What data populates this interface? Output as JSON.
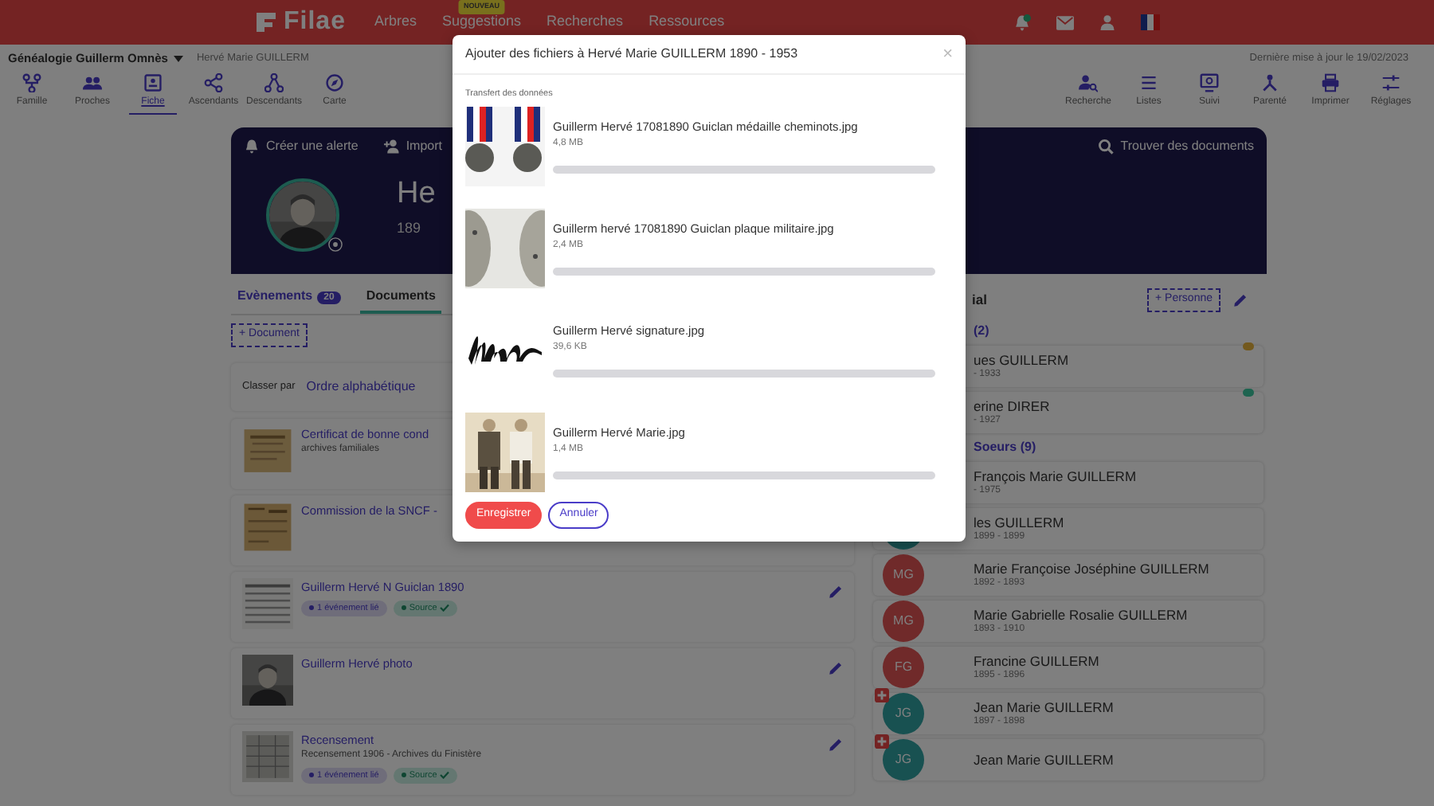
{
  "topbar": {
    "logo": "Filae",
    "has_notification": true,
    "nav": [
      {
        "label": "Arbres"
      },
      {
        "label": "Suggestions",
        "badge": "NOUVEAU"
      },
      {
        "label": "Recherches"
      },
      {
        "label": "Ressources"
      }
    ]
  },
  "tree": {
    "name": "Généalogie Guillerm Omnès",
    "person": "Hervé Marie GUILLERM",
    "updated": "Dernière mise à jour le 19/02/2023"
  },
  "toolbar_left": [
    {
      "label": "Famille",
      "selected": false
    },
    {
      "label": "Proches",
      "selected": false
    },
    {
      "label": "Fiche",
      "selected": true
    },
    {
      "label": "Ascendants",
      "selected": false
    },
    {
      "label": "Descendants",
      "selected": false
    },
    {
      "label": "Carte",
      "selected": false
    }
  ],
  "toolbar_right": [
    {
      "label": "Recherche",
      "selected": false
    },
    {
      "label": "Listes",
      "selected": false
    },
    {
      "label": "Suivi",
      "selected": false
    },
    {
      "label": "Parenté",
      "selected": false
    },
    {
      "label": "Imprimer",
      "selected": false
    },
    {
      "label": "Réglages",
      "selected": false
    }
  ],
  "profile": {
    "actions": [
      "Créer une alerte",
      "Import"
    ],
    "find": "Trouver des documents",
    "name": "He",
    "dates": "189"
  },
  "tabs": [
    {
      "label": "Evènements",
      "count": "20",
      "selected": false
    },
    {
      "label": "Documents",
      "selected": true
    }
  ],
  "add_document": "+ Document",
  "sort": {
    "label": "Classer par",
    "value": "Ordre alphabétique"
  },
  "documents": [
    {
      "title": "Certificat de bonne cond",
      "subtitle": "archives familiales",
      "edit": false
    },
    {
      "title": "Commission de la SNCF -",
      "edit": false
    },
    {
      "title": "Guillerm Hervé N Guiclan 1890",
      "chips": [
        {
          "label": "1 événement lié",
          "kind": "link"
        },
        {
          "label": "Source",
          "kind": "source"
        }
      ],
      "edit": true
    },
    {
      "title": "Guillerm Hervé photo",
      "edit": true
    },
    {
      "title": "Recensement",
      "subtitle": "Recensement 1906 - Archives du Finistère",
      "chips": [
        {
          "label": "1 événement lié",
          "kind": "link"
        },
        {
          "label": "Source",
          "kind": "source"
        }
      ],
      "edit": true
    }
  ],
  "family": {
    "title": "ial",
    "add": "+ Personne",
    "groups": [
      {
        "title": "(2)",
        "kind": "parents",
        "members": [
          {
            "name": "ues GUILLERM",
            "dates": "- 1933",
            "color": "#73591e"
          },
          {
            "name": "erine DIRER",
            "dates": "- 1927",
            "color": "#1e6450"
          }
        ]
      },
      {
        "title": "Soeurs (9)",
        "kind": "siblings",
        "members": [
          {
            "name": "François Marie GUILLERM",
            "dates": "- 1975"
          },
          {
            "name": "les GUILLERM",
            "dates": "1899 - 1899",
            "color": "#185151"
          },
          {
            "name": "Marie Françoise Joséphine GUILLERM",
            "dates": "1892 - 1893",
            "initials": "MG",
            "color": "#702a2a"
          },
          {
            "name": "Marie Gabrielle Rosalie GUILLERM",
            "dates": "1893 - 1910",
            "initials": "MG",
            "color": "#702a2a"
          },
          {
            "name": "Francine GUILLERM",
            "dates": "1895 - 1896",
            "initials": "FG",
            "color": "#702a2a"
          },
          {
            "name": "Jean Marie GUILLERM",
            "dates": "1897 - 1898",
            "initials": "JG",
            "color": "#185151",
            "flagged": true
          },
          {
            "name": "Jean Marie GUILLERM",
            "initials": "JG",
            "color": "#185151",
            "flagged": true
          }
        ]
      }
    ]
  },
  "modal": {
    "title": "Ajouter des fichiers à Hervé Marie GUILLERM 1890 - 1953",
    "close": "×",
    "section": "Transfert des données",
    "files": [
      {
        "name": "Guillerm Hervé 17081890 Guiclan médaille cheminots.jpg",
        "size": "4,8 MB",
        "level": 0
      },
      {
        "name": "Guillerm hervé 17081890 Guiclan plaque militaire.jpg",
        "size": "2,4 MB",
        "level": 0
      },
      {
        "name": "Guillerm Hervé signature.jpg",
        "size": "39,6 KB",
        "level": 0
      },
      {
        "name": "Guillerm Hervé Marie.jpg",
        "size": "1,4 MB",
        "level": 0
      }
    ],
    "buttons": [
      {
        "label": "Enregistrer",
        "kind": "primary"
      },
      {
        "label": "Annuler",
        "kind": "outline"
      }
    ]
  }
}
